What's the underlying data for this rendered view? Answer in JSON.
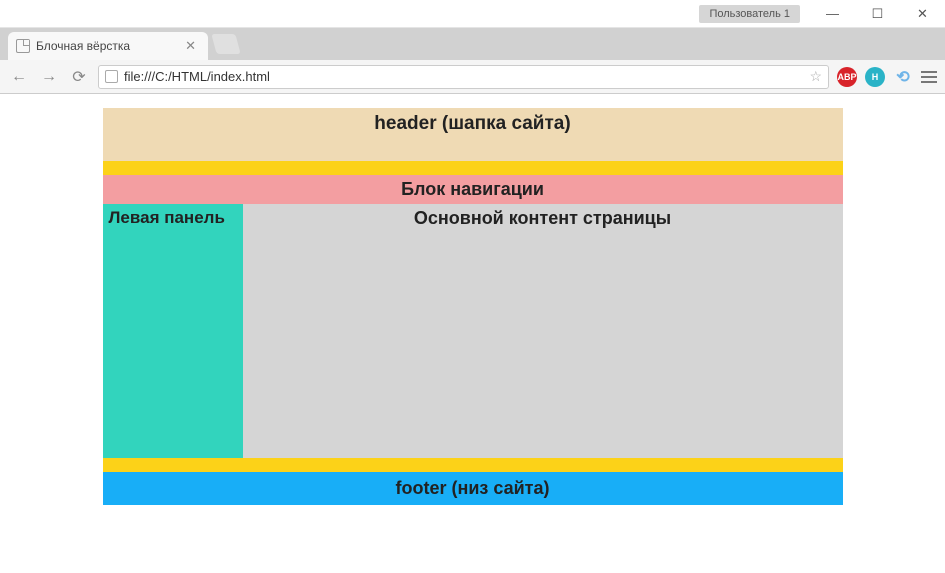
{
  "window": {
    "user_badge": "Пользователь 1",
    "minimize": "—",
    "maximize": "☐",
    "close": "✕"
  },
  "tab": {
    "title": "Блочная вёрстка",
    "close": "✕"
  },
  "toolbar": {
    "back": "←",
    "forward": "→",
    "reload": "⟳",
    "url": "file:///C:/HTML/index.html",
    "star": "☆",
    "abp": "ABP",
    "h": "H",
    "sync": "⟲"
  },
  "page": {
    "header": "header (шапка сайта)",
    "nav": "Блок навигации",
    "left_panel": "Левая панель",
    "main_content": "Основной контент страницы",
    "footer": "footer (низ сайта)"
  }
}
